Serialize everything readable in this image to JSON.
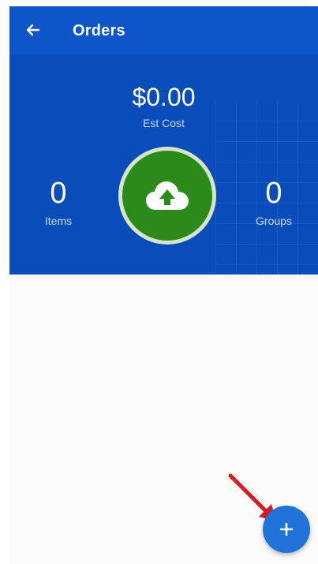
{
  "appbar": {
    "back_icon": "arrow-left-icon",
    "title": "Orders"
  },
  "summary": {
    "est_cost_value": "$0.00",
    "est_cost_label": "Est Cost",
    "items_value": "0",
    "items_label": "Items",
    "groups_value": "0",
    "groups_label": "Groups",
    "upload_icon": "cloud-upload-icon"
  },
  "fab": {
    "icon": "plus-icon",
    "label": "+"
  },
  "annotation": {
    "icon": "red-arrow-icon"
  },
  "colors": {
    "header_bg": "#0a4cba",
    "appbar_bg": "#0c56c9",
    "upload_green": "#2a8a1a",
    "fab_blue": "#1f73d9",
    "arrow_red": "#d81b1b"
  }
}
